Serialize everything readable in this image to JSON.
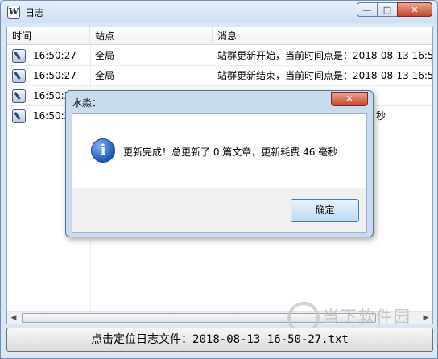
{
  "window": {
    "title": "日志",
    "app_icon_glyph": "W",
    "minimize": "—",
    "maximize": "□",
    "close": "✕"
  },
  "list": {
    "columns": [
      "时间",
      "站点",
      "消息"
    ],
    "rows": [
      {
        "time": "16:50:27",
        "site": "全局",
        "message": "站群更新开始，当前时间点是：2018-08-13 16:50:27"
      },
      {
        "time": "16:50:27",
        "site": "全局",
        "message": "站群更新结束，当前时间点是：2018-08-13 16:50:27"
      },
      {
        "time": "16:50:2",
        "site": "",
        "message": ""
      },
      {
        "time": "16:50:2",
        "site": "",
        "message": "秒"
      }
    ],
    "scroll_left": "◀",
    "scroll_right": "▶"
  },
  "footer": {
    "button_label": "点击定位日志文件：2018-08-13 16-50-27.txt"
  },
  "dialog": {
    "title": "水淼：",
    "close": "✕",
    "info_glyph": "i",
    "message": "更新完成！总更新了 0 篇文章，更新耗费 46 毫秒",
    "ok_label": "确定"
  },
  "watermark": {
    "text": "当下软件园",
    "url": "www.downxia.com"
  },
  "icons": [
    "app-logo-icon",
    "minimize-icon",
    "maximize-icon",
    "close-icon",
    "log-entry-icon",
    "info-icon",
    "watermark-logo-icon"
  ]
}
